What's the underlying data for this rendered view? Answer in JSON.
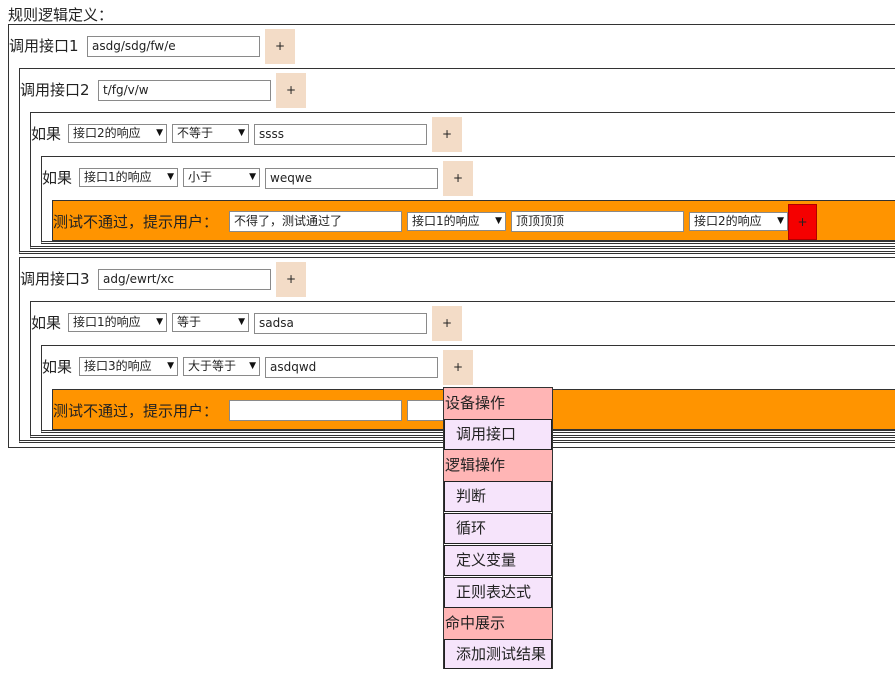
{
  "page": {
    "title": "规则逻辑定义："
  },
  "block1": {
    "label": "调用接口1",
    "path": "asdg/sdg/fw/e",
    "plus": "+",
    "block2": {
      "label": "调用接口2",
      "path": "t/fg/v/w",
      "plus": "+",
      "cond1": {
        "label": "如果",
        "source": "接口2的响应",
        "op": "不等于",
        "value": "ssss",
        "plus": "+",
        "cond2": {
          "label": "如果",
          "source": "接口1的响应",
          "op": "小于",
          "value": "weqwe",
          "plus": "+",
          "fail": {
            "label": "测试不通过，提示用户：",
            "text1": "不得了，测试通过了",
            "select1": "接口1的响应",
            "text2": "顶顶顶顶",
            "select2": "接口2的响应",
            "plus": "+"
          }
        }
      }
    },
    "block3": {
      "label": "调用接口3",
      "path": "adg/ewrt/xc",
      "plus": "+",
      "cond1": {
        "label": "如果",
        "source": "接口1的响应",
        "op": "等于",
        "value": "sadsa",
        "plus": "+",
        "cond2": {
          "label": "如果",
          "source": "接口3的响应",
          "op": "大于等于",
          "value": "asdqwd",
          "plus": "+",
          "fail": {
            "label": "测试不通过，提示用户：",
            "text1": "",
            "text2": ""
          }
        }
      }
    }
  },
  "menu": {
    "cat_device": "设备操作",
    "item_call": "调用接口",
    "cat_logic": "逻辑操作",
    "item_judge": "判断",
    "item_loop": "循环",
    "item_var": "定义变量",
    "item_regex": "正则表达式",
    "cat_show": "命中展示",
    "item_add_result": "添加测试结果"
  },
  "colors": {
    "accent_orange": "#ff9400",
    "plus_button": "#f3dcc7",
    "plus_active": "#f50000",
    "menu_category": "#ffb5b5",
    "menu_item": "#f6e4fb"
  }
}
